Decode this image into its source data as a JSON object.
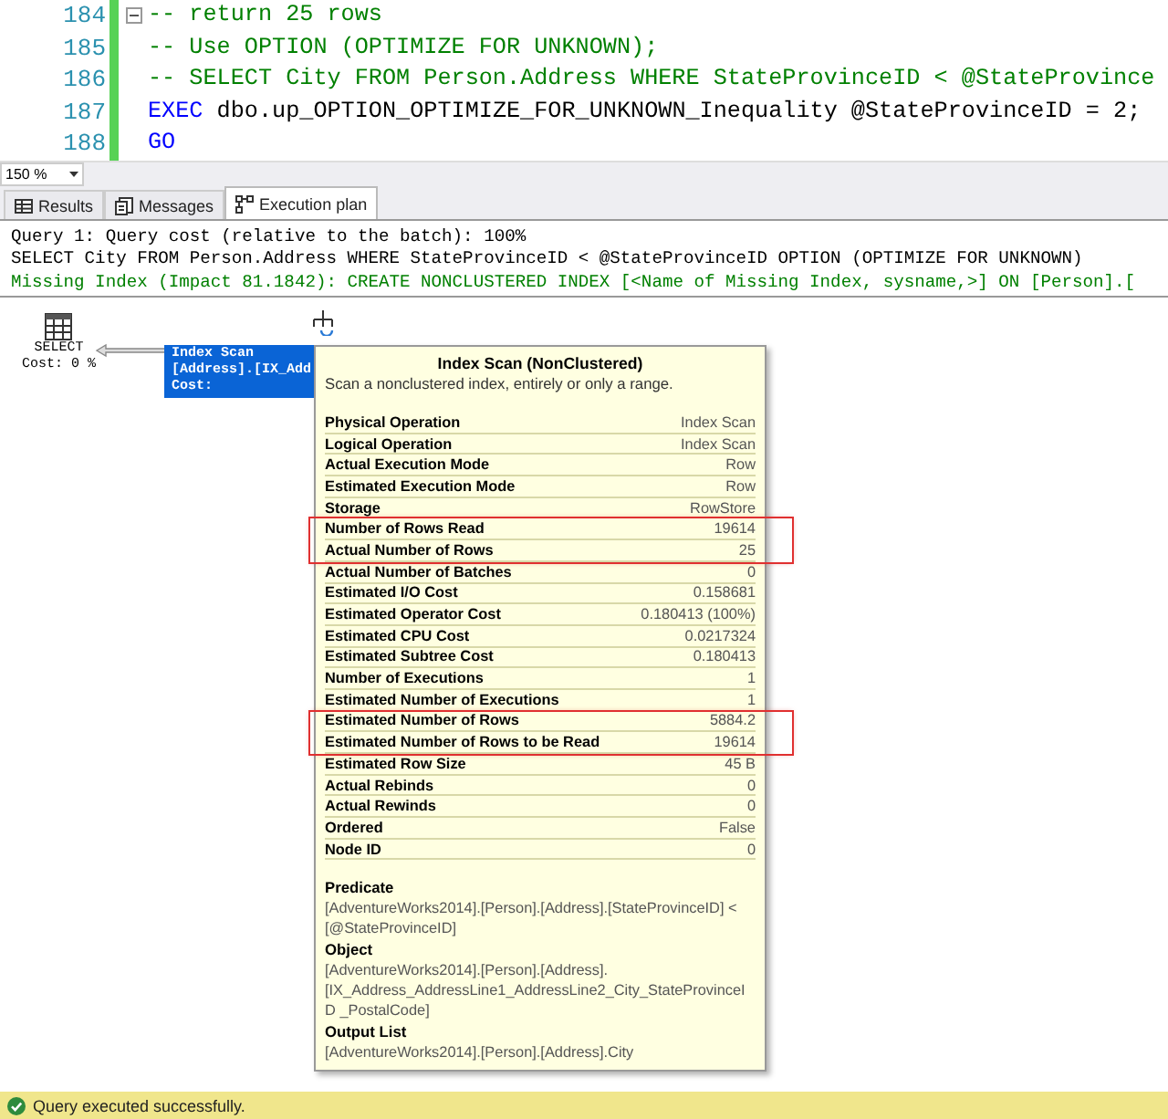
{
  "editor": {
    "lines": [
      {
        "number": "184",
        "fold": true,
        "tokens": [
          {
            "kind": "comment",
            "text": "-- return 25 rows"
          }
        ]
      },
      {
        "number": "185",
        "fold": false,
        "tokens": [
          {
            "kind": "comment",
            "text": "-- Use OPTION (OPTIMIZE FOR UNKNOWN);"
          }
        ]
      },
      {
        "number": "186",
        "fold": false,
        "tokens": [
          {
            "kind": "comment",
            "text": "-- SELECT City FROM Person.Address WHERE StateProvinceID < @StateProvince"
          }
        ]
      },
      {
        "number": "187",
        "fold": false,
        "tokens": [
          {
            "kind": "keyword",
            "text": "EXEC"
          },
          {
            "kind": "plain",
            "text": " dbo.up_OPTION_OPTIMIZE_FOR_UNKNOWN_Inequality @StateProvinceID = 2;"
          }
        ]
      },
      {
        "number": "188",
        "fold": false,
        "tokens": [
          {
            "kind": "keyword",
            "text": "GO"
          }
        ]
      }
    ]
  },
  "zoom": {
    "value": "150 %"
  },
  "tabs": [
    {
      "label": "Results",
      "selected": false
    },
    {
      "label": "Messages",
      "selected": false
    },
    {
      "label": "Execution plan",
      "selected": true
    }
  ],
  "messages": [
    {
      "kind": "plain",
      "text": "Query 1: Query cost (relative to the batch): 100%"
    },
    {
      "kind": "plain",
      "text": "SELECT City FROM Person.Address WHERE StateProvinceID < @StateProvinceID OPTION (OPTIMIZE FOR UNKNOWN)"
    },
    {
      "kind": "hint",
      "text": "Missing Index (Impact 81.1842): CREATE NONCLUSTERED INDEX [<Name of Missing Index, sysname,>] ON [Person].["
    }
  ],
  "plan": {
    "select_node": {
      "label": "SELECT",
      "cost": "Cost: 0 %"
    },
    "scan_node": {
      "lines": [
        "Index Scan",
        "[Address].[IX_Add",
        "Cost:"
      ],
      "selected": true
    }
  },
  "tooltip": {
    "title": "Index Scan (NonClustered)",
    "description": "Scan a nonclustered index, entirely or only a range.",
    "properties": [
      {
        "name": "Physical Operation",
        "value": "Index Scan",
        "highlighted": false
      },
      {
        "name": "Logical Operation",
        "value": "Index Scan",
        "highlighted": false
      },
      {
        "name": "Actual Execution Mode",
        "value": "Row",
        "highlighted": false
      },
      {
        "name": "Estimated Execution Mode",
        "value": "Row",
        "highlighted": false
      },
      {
        "name": "Storage",
        "value": "RowStore",
        "highlighted": false
      },
      {
        "name": "Number of Rows Read",
        "value": "19614",
        "highlighted": true
      },
      {
        "name": "Actual Number of Rows",
        "value": "25",
        "highlighted": true
      },
      {
        "name": "Actual Number of Batches",
        "value": "0",
        "highlighted": false
      },
      {
        "name": "Estimated I/O Cost",
        "value": "0.158681",
        "highlighted": false
      },
      {
        "name": "Estimated Operator Cost",
        "value": "0.180413 (100%)",
        "highlighted": false
      },
      {
        "name": "Estimated CPU Cost",
        "value": "0.0217324",
        "highlighted": false
      },
      {
        "name": "Estimated Subtree Cost",
        "value": "0.180413",
        "highlighted": false
      },
      {
        "name": "Number of Executions",
        "value": "1",
        "highlighted": false
      },
      {
        "name": "Estimated Number of Executions",
        "value": "1",
        "highlighted": false
      },
      {
        "name": "Estimated Number of Rows",
        "value": "5884.2",
        "highlighted": true
      },
      {
        "name": "Estimated Number of Rows to be Read",
        "value": "19614",
        "highlighted": true
      },
      {
        "name": "Estimated Row Size",
        "value": "45 B",
        "highlighted": false
      },
      {
        "name": "Actual Rebinds",
        "value": "0",
        "highlighted": false
      },
      {
        "name": "Actual Rewinds",
        "value": "0",
        "highlighted": false
      },
      {
        "name": "Ordered",
        "value": "False",
        "highlighted": false
      },
      {
        "name": "Node ID",
        "value": "0",
        "highlighted": false
      }
    ],
    "sections": [
      {
        "heading": "Predicate",
        "text": "[AdventureWorks2014].[Person].[Address].[StateProvinceID] < [@StateProvinceID]"
      },
      {
        "heading": "Object",
        "text": "[AdventureWorks2014].[Person].[Address]. [IX_Address_AddressLine1_AddressLine2_City_StateProvinceID _PostalCode]"
      },
      {
        "heading": "Output List",
        "text": "[AdventureWorks2014].[Person].[Address].City"
      }
    ]
  },
  "status_bar": {
    "text": "Query executed successfully."
  }
}
